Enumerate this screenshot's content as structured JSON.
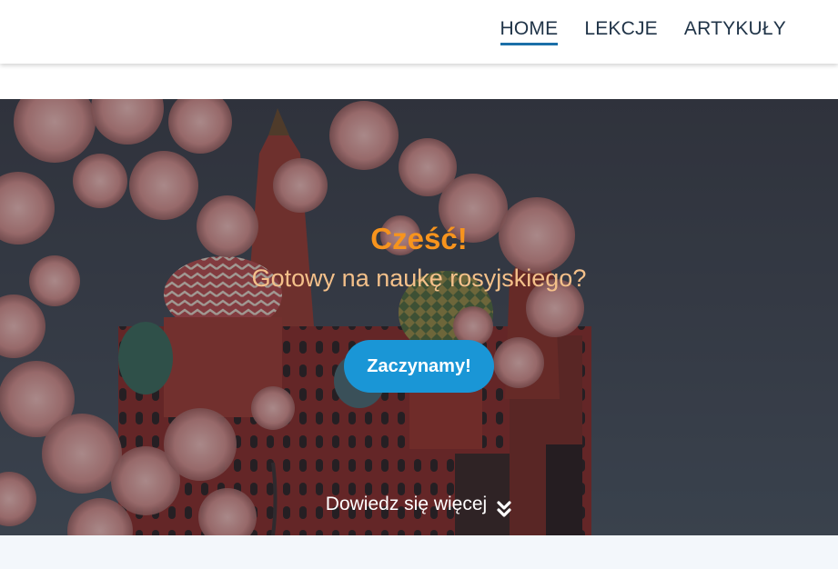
{
  "nav": {
    "items": [
      {
        "label": "HOME",
        "active": true
      },
      {
        "label": "LEKCJE",
        "active": false
      },
      {
        "label": "ARTYKUŁY",
        "active": false
      }
    ]
  },
  "hero": {
    "title": "Cześć!",
    "subtitle": "Gotowy na naukę rosyjskiego?",
    "cta_label": "Zaczynamy!",
    "learn_more_label": "Dowiedz się więcej",
    "learn_more_icon": "double-chevron-down-icon",
    "background_image": "st-basils-cathedral-with-cherry-blossoms"
  },
  "colors": {
    "title": "#f7941d",
    "subtitle": "#f4c08a",
    "cta": "#1a96d6",
    "nav_active_underline": "#1b6fa8"
  }
}
